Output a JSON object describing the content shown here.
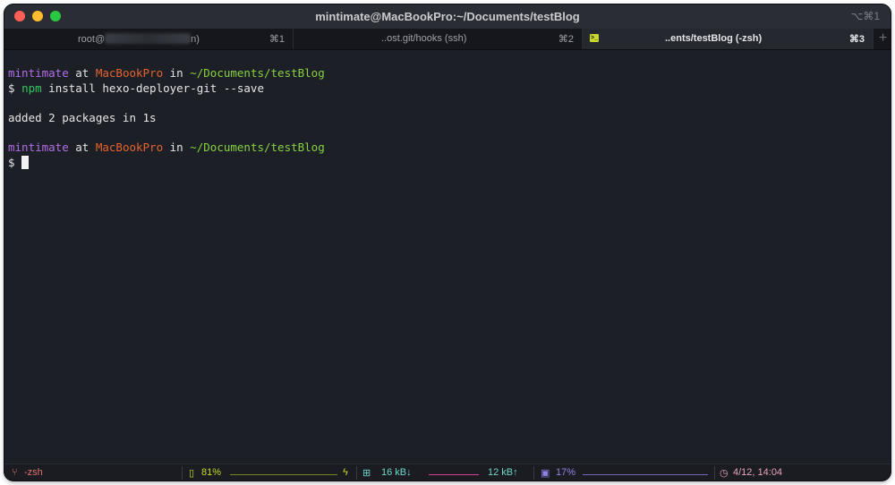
{
  "window": {
    "title": "mintimate@MacBookPro:~/Documents/testBlog",
    "shortcut": "⌥⌘1"
  },
  "tabs": [
    {
      "label_prefix": "root@",
      "label_suffix": "n)",
      "shortcut": "⌘1",
      "active": false
    },
    {
      "label": "..ost.git/hooks (ssh)",
      "shortcut": "⌘2",
      "active": false
    },
    {
      "label": "..ents/testBlog (-zsh)",
      "shortcut": "⌘3",
      "active": true
    }
  ],
  "new_tab_label": "+",
  "terminal": {
    "prompt1": {
      "user": "mintimate",
      "at": " at ",
      "host": "MacBookPro",
      "in": " in ",
      "path": "~/Documents/testBlog"
    },
    "command_line": {
      "sign": "$ ",
      "cmd": "npm",
      "args": " install hexo-deployer-git --save"
    },
    "output": "added 2 packages in 1s",
    "prompt2": {
      "user": "mintimate",
      "at": " at ",
      "host": "MacBookPro",
      "in": " in ",
      "path": "~/Documents/testBlog"
    },
    "active_prompt": "$ "
  },
  "status": {
    "shell": "-zsh",
    "battery": "81%",
    "net_down": "16 kB↓",
    "net_up": "12 kB↑",
    "cpu": "17%",
    "clock": "4/12, 14:04"
  },
  "colors": {
    "user": "#b26ee8",
    "host": "#e5632e",
    "path": "#86d23f",
    "npm": "#35c55f",
    "shell_status": "#e0726a",
    "battery": "#c9d82a",
    "network": "#6fd6c9",
    "network_graph": "#d6428e",
    "cpu": "#8e83e8",
    "clock": "#e8a3b8"
  }
}
